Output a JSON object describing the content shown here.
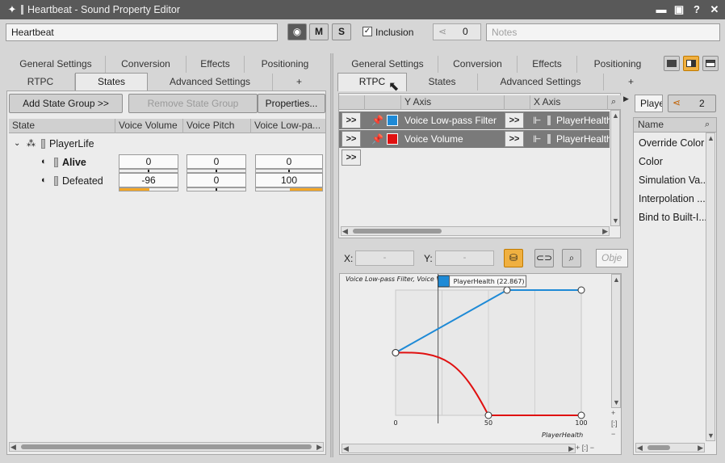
{
  "window": {
    "title": "Heartbeat - Sound Property Editor"
  },
  "header": {
    "object_name": "Heartbeat",
    "m_label": "M",
    "s_label": "S",
    "inclusion_label": "Inclusion",
    "inclusion_checked": true,
    "references_count": "0",
    "notes_placeholder": "Notes"
  },
  "left_tabs": {
    "row1": [
      "General Settings",
      "Conversion",
      "Effects",
      "Positioning"
    ],
    "row2": [
      "RTPC",
      "States",
      "Advanced Settings",
      "+"
    ],
    "active": "States"
  },
  "states_panel": {
    "add_button": "Add State Group >>",
    "remove_button": "Remove State Group",
    "properties_button": "Properties...",
    "columns": [
      "State",
      "Voice Volume",
      "Voice Pitch",
      "Voice Low-pa..."
    ],
    "group": "PlayerLife",
    "rows": [
      {
        "name": "Alive",
        "values": [
          "0",
          "0",
          "0"
        ]
      },
      {
        "name": "Defeated",
        "values": [
          "-96",
          "0",
          "100"
        ]
      }
    ]
  },
  "right_tabs": {
    "row1": [
      "General Settings",
      "Conversion",
      "Effects",
      "Positioning"
    ],
    "row2": [
      "RTPC",
      "States",
      "Advanced Settings",
      "+"
    ],
    "active": "RTPC"
  },
  "rtpc_panel": {
    "columns": [
      "Y Axis",
      "X Axis"
    ],
    "rows": [
      {
        "y_axis": "Voice Low-pass Filter",
        "color": "#1e8ad6",
        "x_axis": "PlayerHealth"
      },
      {
        "y_axis": "Voice Volume",
        "color": "#e01010",
        "x_axis": "PlayerHealth"
      }
    ],
    "expand_label": ">>"
  },
  "graph": {
    "x_label": "X:",
    "y_label": "Y:",
    "x_value": "-",
    "y_value": "-",
    "object_placeholder": "Obje",
    "curve_title": "Voice Low-pass Filter, Voice V",
    "tooltip": "PlayerHealth (22.867)",
    "x_axis_name": "PlayerHealth",
    "tick_labels": [
      "0",
      "50",
      "100"
    ]
  },
  "far_right": {
    "filter_value": "Playe",
    "share_count": "2",
    "list_header": "Name",
    "items": [
      "Override Color",
      "Color",
      "Simulation Va...",
      "Interpolation ...",
      "Bind to Built-I..."
    ]
  },
  "chart_data": {
    "type": "line",
    "xlabel": "PlayerHealth",
    "xlim": [
      0,
      100
    ],
    "ylim": [
      0,
      1
    ],
    "series": [
      {
        "name": "Voice Low-pass Filter",
        "color": "#1e8ad6",
        "points": [
          [
            0,
            0.5
          ],
          [
            60,
            1.0
          ],
          [
            100,
            1.0
          ]
        ]
      },
      {
        "name": "Voice Volume",
        "color": "#e01010",
        "points": [
          [
            0,
            0.5
          ],
          [
            50,
            0.0
          ],
          [
            100,
            0.0
          ]
        ]
      }
    ],
    "cursor_x": 22.867
  }
}
